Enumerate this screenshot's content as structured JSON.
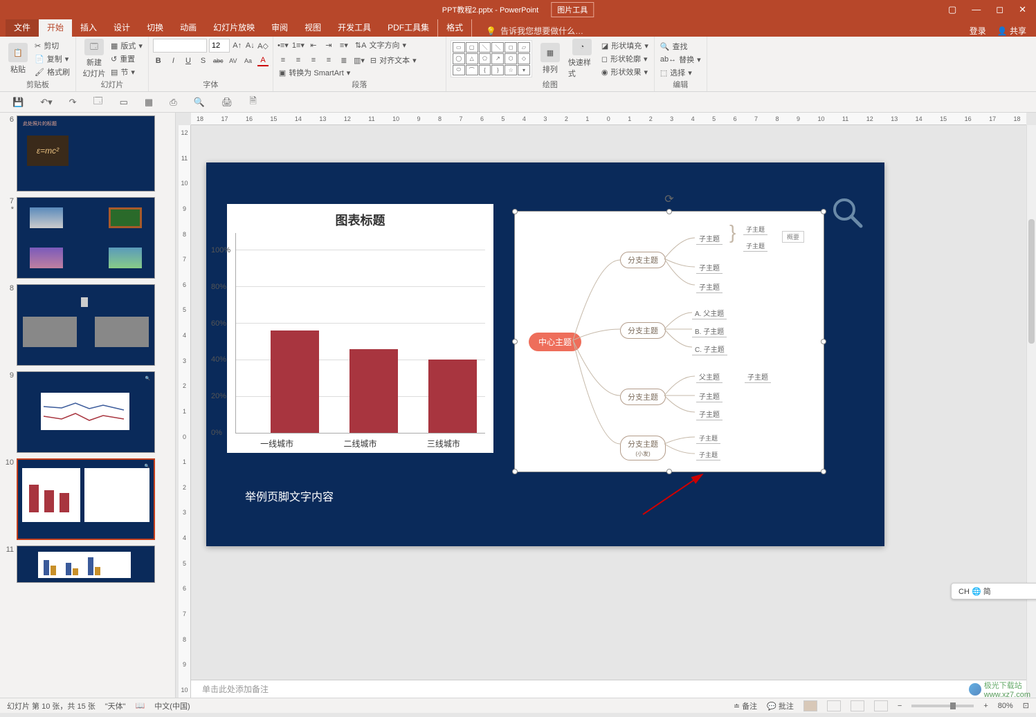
{
  "title_bar": {
    "doc_title": "PPT教程2.pptx - PowerPoint",
    "pic_tool": "图片工具",
    "win_icons": [
      "▭",
      "—",
      "◻",
      "✕"
    ]
  },
  "tabs": {
    "file": "文件",
    "home": "开始",
    "insert": "插入",
    "design": "设计",
    "transitions": "切换",
    "animations": "动画",
    "slideshow": "幻灯片放映",
    "review": "审阅",
    "view": "视图",
    "developer": "开发工具",
    "pdftools": "PDF工具集",
    "format": "格式",
    "tellme_placeholder": "告诉我您想要做什么…",
    "login": "登录",
    "share": "共享"
  },
  "ribbon": {
    "clipboard": {
      "paste": "粘贴",
      "cut": "剪切",
      "copy": "复制",
      "format_painter": "格式刷",
      "label": "剪贴板"
    },
    "slides": {
      "new_slide": "新建\n幻灯片",
      "layout": "版式",
      "reset": "重置",
      "section": "节",
      "label": "幻灯片"
    },
    "font": {
      "family": "",
      "size": "12",
      "label": "字体",
      "btnB": "B",
      "btnI": "I",
      "btnU": "U",
      "btnS": "S",
      "btnAbc": "abc",
      "btnAV": "AV",
      "btnAa": "Aa",
      "btnA": "A"
    },
    "paragraph": {
      "text_direction": "文字方向",
      "align_text": "对齐文本",
      "convert_smartart": "转换为 SmartArt",
      "label": "段落"
    },
    "drawing": {
      "arrange": "排列",
      "quick_style": "快速样式",
      "shape_fill": "形状填充",
      "shape_outline": "形状轮廓",
      "shape_effects": "形状效果",
      "label": "绘图"
    },
    "editing": {
      "find": "查找",
      "replace": "替换",
      "select": "选择",
      "label": "编辑"
    }
  },
  "ruler_h_ticks": [
    "18",
    "17",
    "16",
    "15",
    "14",
    "13",
    "12",
    "11",
    "10",
    "9",
    "8",
    "7",
    "6",
    "5",
    "4",
    "3",
    "2",
    "1",
    "0",
    "1",
    "2",
    "3",
    "4",
    "5",
    "6",
    "7",
    "8",
    "9",
    "10",
    "11",
    "12",
    "13",
    "14",
    "15",
    "16",
    "17",
    "18"
  ],
  "ruler_v_ticks": [
    "12",
    "11",
    "10",
    "9",
    "8",
    "7",
    "6",
    "5",
    "4",
    "3",
    "2",
    "1",
    "0",
    "1",
    "2",
    "3",
    "4",
    "5",
    "6",
    "7",
    "8",
    "9",
    "10"
  ],
  "thumbs": [
    {
      "num": "6",
      "title": "此处照片的标题"
    },
    {
      "num": "7",
      "star": "*"
    },
    {
      "num": "8"
    },
    {
      "num": "9"
    },
    {
      "num": "10",
      "selected": true
    },
    {
      "num": "11"
    }
  ],
  "slide": {
    "footer_text": "举例页脚文字内容",
    "mindmap": {
      "central": "中心主题",
      "branch": "分支主题",
      "leaf_sub": "子主题",
      "leaf_parent_a": "A.  父主题",
      "leaf_parent_b": "B.  子主题",
      "leaf_parent_c": "C.  子主题",
      "leaf_parent": "父主题",
      "branch_small": "(小发)",
      "overview": "概要"
    }
  },
  "chart_data": {
    "type": "bar",
    "title": "图表标题",
    "categories": [
      "一线城市",
      "二线城市",
      "三线城市"
    ],
    "values": [
      56,
      46,
      40
    ],
    "ylabel": "",
    "ylim": [
      0,
      100
    ],
    "yticks": [
      "0%",
      "20%",
      "40%",
      "60%",
      "80%",
      "100%"
    ],
    "bar_color": "#a8353f"
  },
  "notes_placeholder": "单击此处添加备注",
  "status": {
    "slide_info": "幻灯片 第 10 张，共 15 张",
    "theme": "\"天体\"",
    "lang": "中文(中国)",
    "notes_btn": "备注",
    "comments_btn": "批注",
    "zoom": "80%"
  },
  "ime": "CH 🌐 简",
  "qat_icons": [
    "💾",
    "↶",
    "↷",
    "🖼",
    "🗔",
    "▭",
    "▦",
    "🔍",
    "⎘",
    "🗎"
  ],
  "watermark": {
    "line1": "极光下载站",
    "line2": "www.xz7.com"
  }
}
